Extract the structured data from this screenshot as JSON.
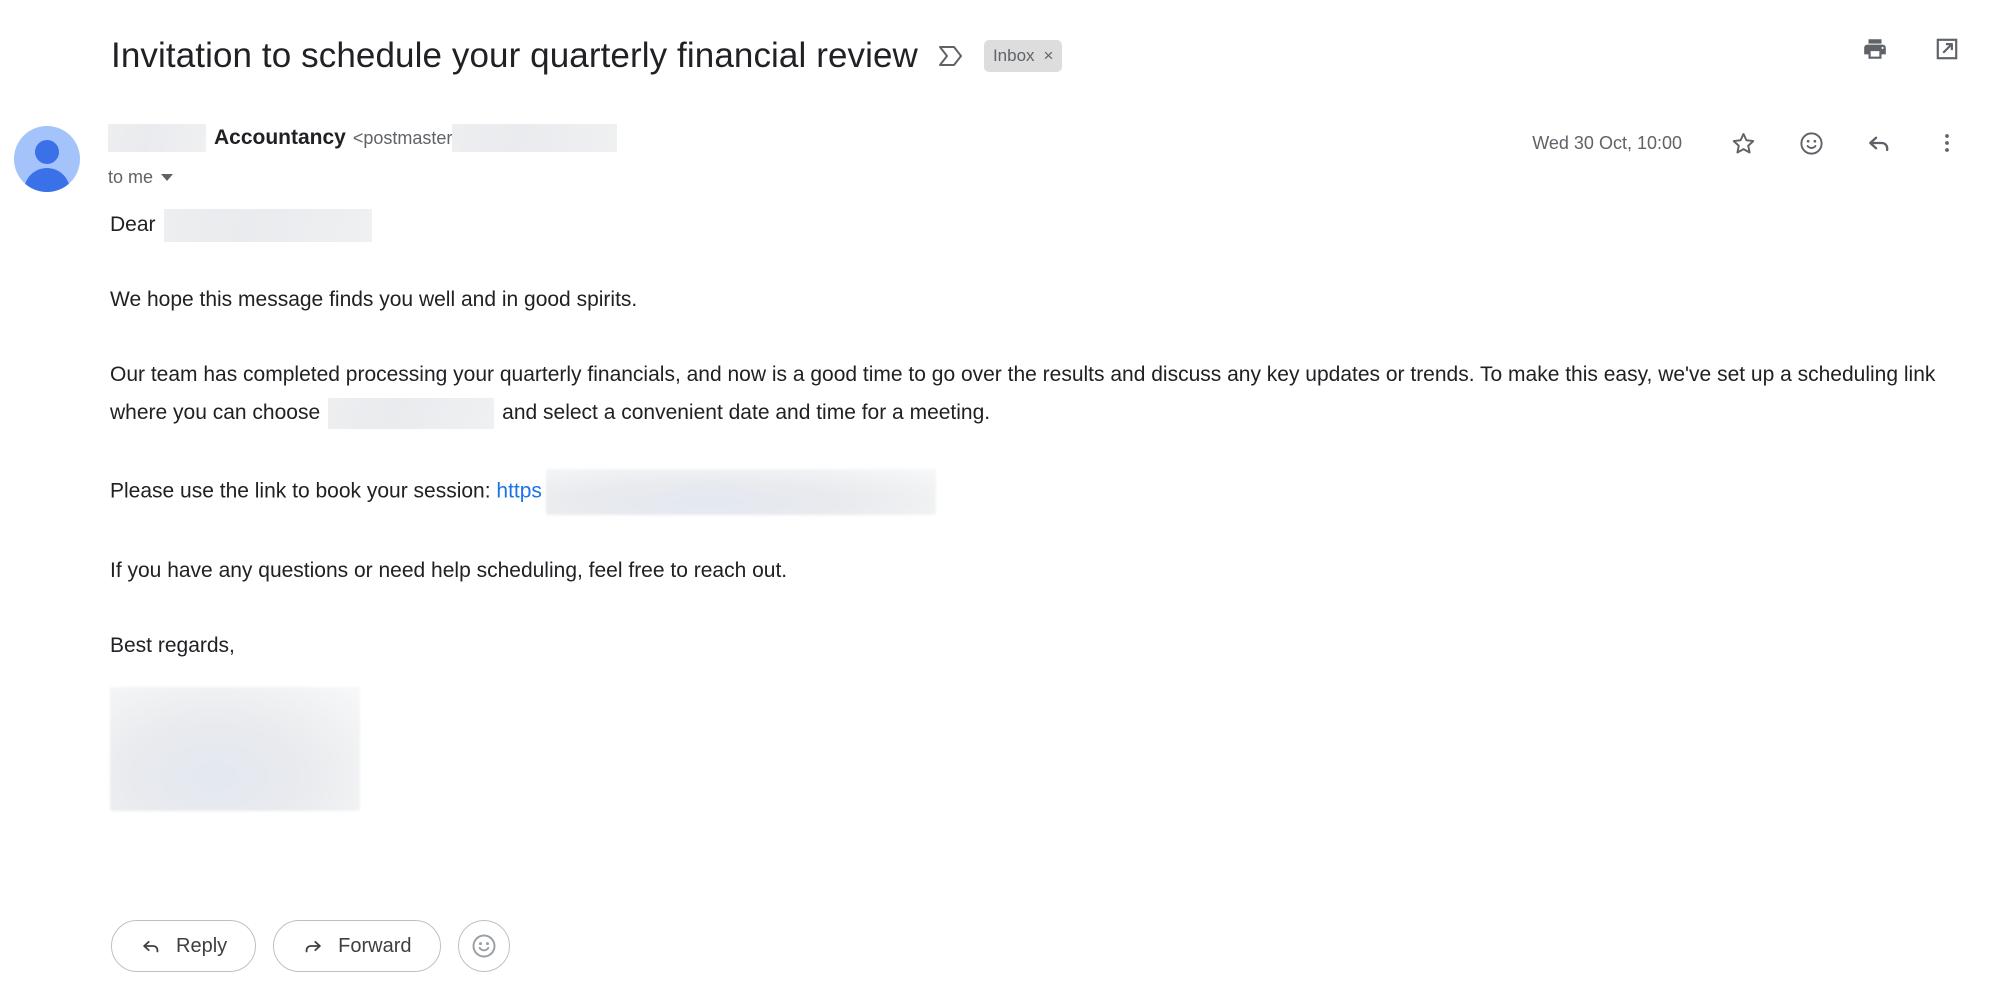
{
  "subject": {
    "text": "Invitation to schedule your quarterly financial review",
    "important_marker_icon": "important-marker-icon",
    "label": "Inbox",
    "label_close": "×"
  },
  "header_actions": [
    {
      "name": "print-icon",
      "title": "Print all"
    },
    {
      "name": "open-in-new-icon",
      "title": "Open in new window"
    }
  ],
  "sender": {
    "avatar_icon": "avatar-person-icon",
    "name": "Accountancy",
    "email": "<postmaster",
    "to_label": "to me",
    "caret_icon": "chevron-down-icon",
    "name_redacted": true,
    "email_redacted": true
  },
  "meta": {
    "timestamp": "Wed 30 Oct, 10:00",
    "actions": [
      {
        "name": "star-icon",
        "title": "Star"
      },
      {
        "name": "add-reaction-icon",
        "title": "Add reaction"
      },
      {
        "name": "reply-icon",
        "title": "Reply"
      },
      {
        "name": "more-options-icon",
        "title": "More"
      }
    ]
  },
  "body": {
    "greeting_prefix": "Dear",
    "p1": "We hope this message finds you well and in good spirits.",
    "p2_a": "Our team has completed processing your quarterly financials, and now is a good time to go over the results and discuss any key updates or trends. To make this easy, we've set up a scheduling link where you can choose",
    "p2_b": "and select a convenient date and time for a meeting.",
    "p3_prefix": "Please use the link to book your session:",
    "p3_link": "https",
    "p4": "If you have any questions or need help scheduling, feel free to reach out.",
    "p5": "Best regards,"
  },
  "actions": {
    "reply": "Reply",
    "forward": "Forward",
    "emoji_title": "Add reaction"
  },
  "colors": {
    "link": "#1a73e8",
    "avatar_bg": "#a3c3fa",
    "avatar_fg": "#3b71e8",
    "chip_bg": "#ddddde",
    "icon": "#5f6368",
    "text": "#202124"
  }
}
